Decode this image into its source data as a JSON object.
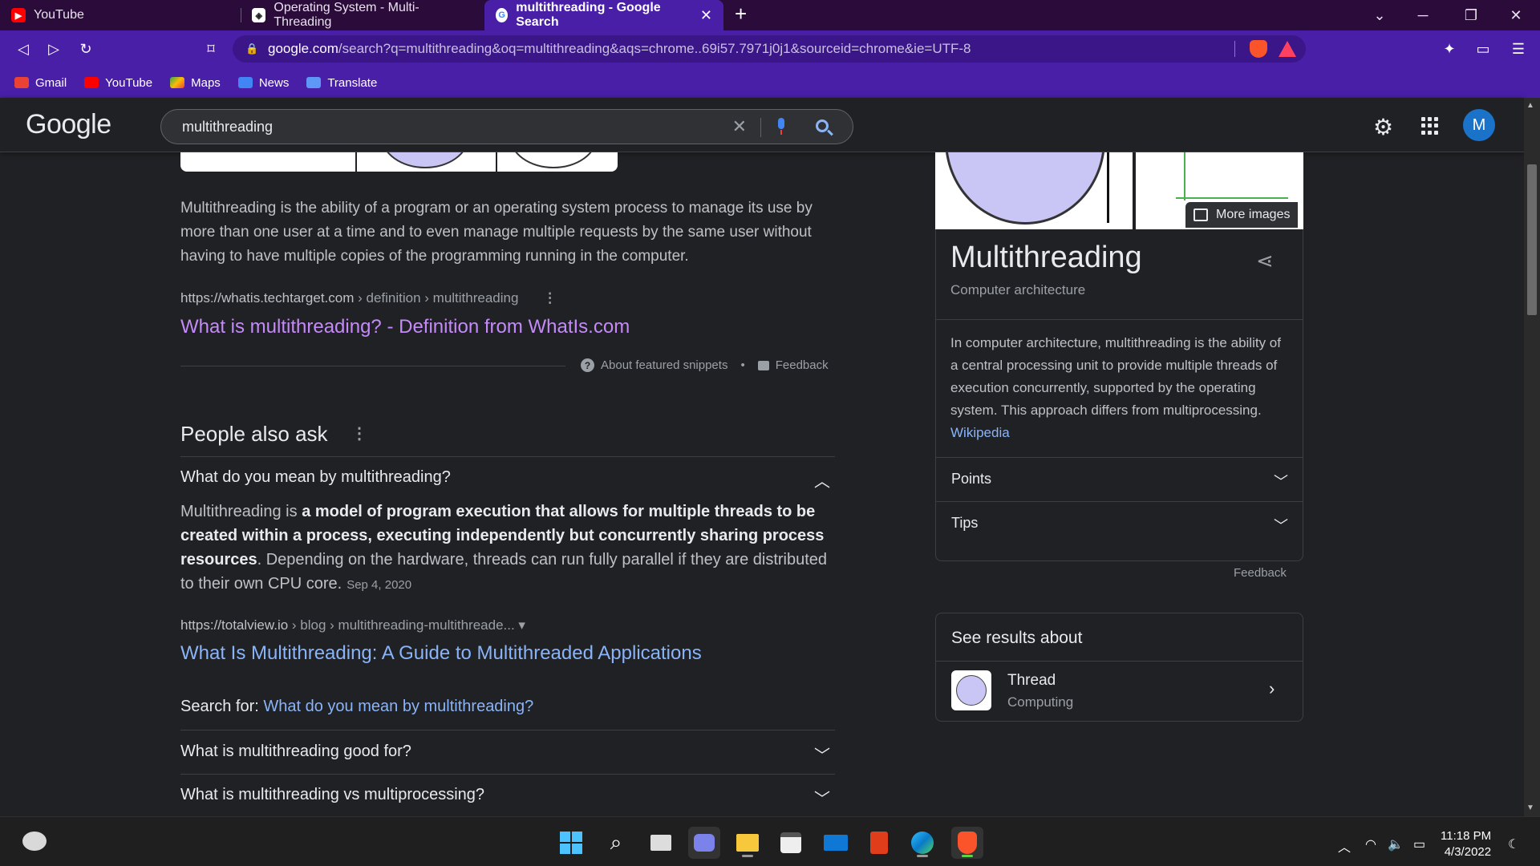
{
  "browser": {
    "tabs": [
      {
        "title": "YouTube"
      },
      {
        "title": "Operating System - Multi-Threading"
      },
      {
        "title": "multithreading - Google Search"
      }
    ],
    "url_host": "google.com",
    "url_rest": "/search?q=multithreading&oq=multithreading&aqs=chrome..69i57.7971j0j1&sourceid=chrome&ie=UTF-8",
    "bookmarks": [
      "Gmail",
      "YouTube",
      "Maps",
      "News",
      "Translate"
    ]
  },
  "google": {
    "logo": "Google",
    "query": "multithreading",
    "avatar_letter": "M"
  },
  "featured": {
    "snippet": "Multithreading is the ability of a program or an operating system process to manage its use by more than one user at a time and to even manage multiple requests by the same user without having to have multiple copies of the programming running in the computer.",
    "cite_host": "https://whatis.techtarget.com",
    "cite_path": " › definition › multithreading",
    "link": "What is multithreading? - Definition from WhatIs.com",
    "about": "About featured snippets",
    "feedback": "Feedback"
  },
  "paa": {
    "title": "People also ask",
    "q1": "What do you mean by multithreading?",
    "a1_pre": "Multithreading is ",
    "a1_bold": "a model of program execution that allows for multiple threads to be created within a process, executing independently but concurrently sharing process resources",
    "a1_post": ". Depending on the hardware, threads can run fully parallel if they are distributed to their own CPU core.",
    "a1_date": "Sep 4, 2020",
    "cite_host": "https://totalview.io",
    "cite_path": " › blog › multithreading-multithreade... ▾",
    "link": "What Is Multithreading: A Guide to Multithreaded Applications",
    "search_for_label": "Search for: ",
    "search_for_link": "What do you mean by multithreading?",
    "q2": "What is multithreading good for?",
    "q3": "What is multithreading vs multiprocessing?"
  },
  "knowledge_panel": {
    "more_images": "More images",
    "title": "Multithreading",
    "subtitle": "Computer architecture",
    "description": "In computer architecture, multithreading is the ability of a central processing unit to provide multiple threads of execution concurrently, supported by the operating system. This approach differs from multiprocessing.",
    "source": "Wikipedia",
    "rows": [
      "Points",
      "Tips"
    ],
    "feedback": "Feedback"
  },
  "see_results": {
    "title": "See results about",
    "name": "Thread",
    "category": "Computing"
  },
  "taskbar": {
    "time": "11:18 PM",
    "date": "4/3/2022"
  }
}
